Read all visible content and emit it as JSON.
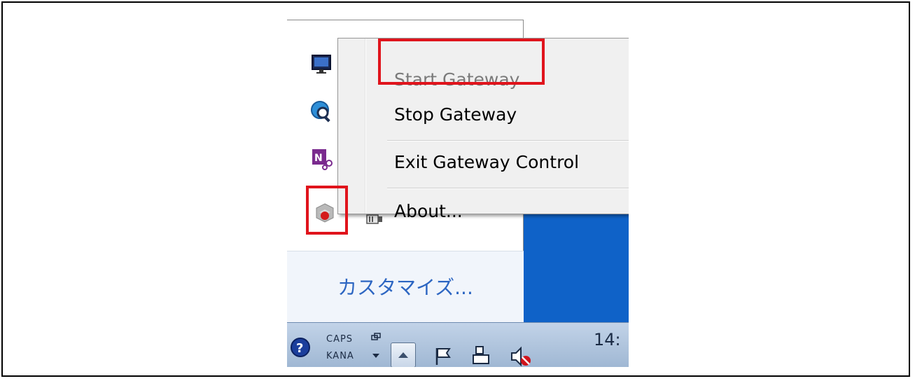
{
  "menu": {
    "items": [
      {
        "label": "Start Gateway",
        "disabled": true
      },
      {
        "label": "Stop Gateway",
        "disabled": false
      },
      {
        "label": "Exit Gateway Control",
        "disabled": false
      },
      {
        "label": "About...",
        "disabled": false
      }
    ]
  },
  "tray_panel": {
    "customize_label": "カスタマイズ...",
    "icons": [
      "monitor-icon",
      "search-globe-icon",
      "onenote-clip-icon",
      "gateway-control-icon",
      "power-plug-icon"
    ]
  },
  "taskbar": {
    "caps_label": "CAPS",
    "kana_label": "KANA",
    "clock_time": "14:",
    "icons": [
      "help-icon",
      "language-bar-icon",
      "show-hidden-icons-button",
      "action-center-flag-icon",
      "network-icon",
      "volume-muted-icon"
    ]
  },
  "highlight_color": "#e0141c",
  "accent_blue": "#0f62c8"
}
